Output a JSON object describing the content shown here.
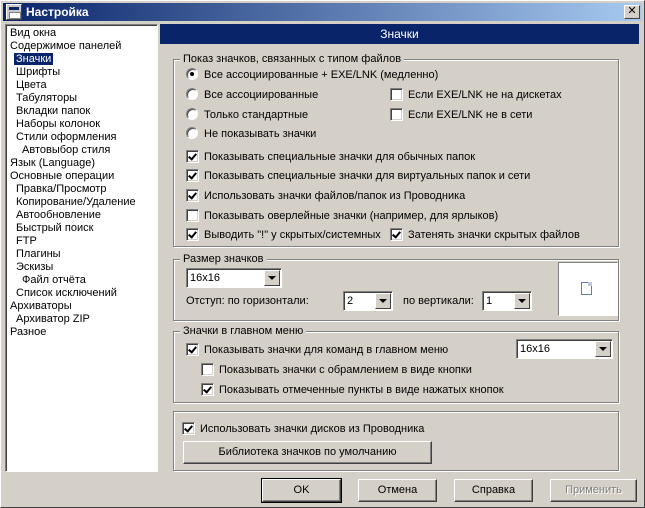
{
  "window": {
    "title": "Настройка",
    "close_glyph": "✕"
  },
  "tree": {
    "items": [
      {
        "label": "Вид окна",
        "indent": 0
      },
      {
        "label": "Содержимое панелей",
        "indent": 0
      },
      {
        "label": "Значки",
        "indent": 1,
        "selected": true
      },
      {
        "label": "Шрифты",
        "indent": 1
      },
      {
        "label": "Цвета",
        "indent": 1
      },
      {
        "label": "Табуляторы",
        "indent": 1
      },
      {
        "label": "Вкладки папок",
        "indent": 1
      },
      {
        "label": "Наборы колонок",
        "indent": 1
      },
      {
        "label": "Стили оформления",
        "indent": 1
      },
      {
        "label": "Автовыбор стиля",
        "indent": 2
      },
      {
        "label": "Язык (Language)",
        "indent": 0
      },
      {
        "label": "Основные операции",
        "indent": 0
      },
      {
        "label": "Правка/Просмотр",
        "indent": 1
      },
      {
        "label": "Копирование/Удаление",
        "indent": 1
      },
      {
        "label": "Автообновление",
        "indent": 1
      },
      {
        "label": "Быстрый поиск",
        "indent": 1
      },
      {
        "label": "FTP",
        "indent": 1
      },
      {
        "label": "Плагины",
        "indent": 1
      },
      {
        "label": "Эскизы",
        "indent": 1
      },
      {
        "label": "Файл отчёта",
        "indent": 2
      },
      {
        "label": "Список исключений",
        "indent": 1
      },
      {
        "label": "Архиваторы",
        "indent": 0
      },
      {
        "label": "Архиватор ZIP",
        "indent": 1
      },
      {
        "label": "Разное",
        "indent": 0
      }
    ]
  },
  "panel": {
    "title": "Значки"
  },
  "filetype_group": {
    "legend": "Показ значков, связанных с типом файлов",
    "radio_all_exe": "Все ассоциированные + EXE/LNK (медленно)",
    "radio_all": "Все ассоциированные",
    "radio_standard": "Только стандартные",
    "radio_none": "Не показывать значки",
    "cb_exe_not_floppy": "Если EXE/LNK не на дискетах",
    "cb_exe_not_network": "Если EXE/LNK не в сети",
    "cb_special_normal": "Показывать специальные значки для обычных папок",
    "cb_special_virtual": "Показывать специальные значки для виртуальных папок и сети",
    "cb_explorer_icons": "Использовать значки файлов/папок из Проводника",
    "cb_overlay": "Показывать оверлейные значки (например, для ярлыков)",
    "cb_hidden_excl": "Выводить \"!\" у скрытых/системных",
    "cb_dim_hidden": "Затенять значки скрытых файлов"
  },
  "size_group": {
    "legend": "Размер значков",
    "size_value": "16x16",
    "indent_h_label": "Отступ: по горизонтали:",
    "indent_h_value": "2",
    "indent_v_label": "по вертикали:",
    "indent_v_value": "1"
  },
  "menu_group": {
    "legend": "Значки в главном меню",
    "cb_show_menu_icons": "Показывать значки для команд в главном меню",
    "menu_size_value": "16x16",
    "cb_framed": "Показывать значки с обрамлением в виде кнопки",
    "cb_pressed": "Показывать отмеченные пункты в виде нажатых кнопок"
  },
  "drive_group": {
    "cb_drive_icons": "Использовать значки дисков из Проводника",
    "library_button": "Библиотека значков по умолчанию"
  },
  "buttons": {
    "ok": "OK",
    "cancel": "Отмена",
    "help": "Справка",
    "apply": "Применить"
  }
}
